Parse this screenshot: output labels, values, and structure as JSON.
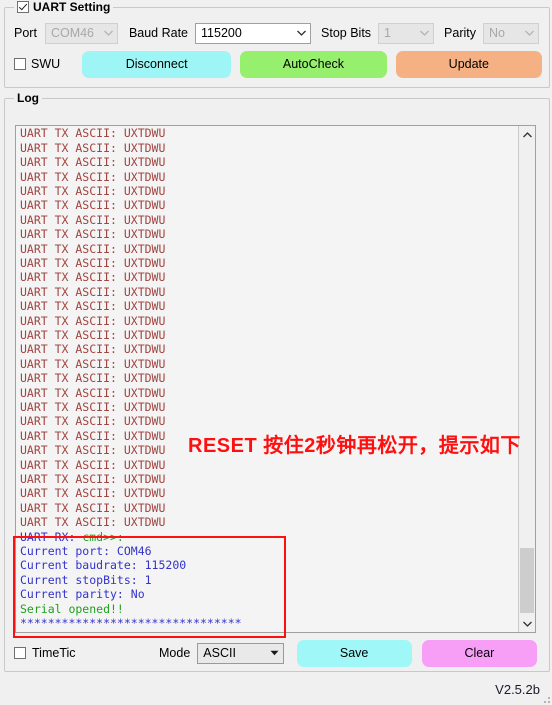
{
  "uart_group": {
    "title": "UART Setting",
    "checked": true,
    "port": {
      "label": "Port",
      "value": "COM46",
      "enabled": false
    },
    "baud_rate": {
      "label": "Baud Rate",
      "value": "115200",
      "enabled": true
    },
    "stop_bits": {
      "label": "Stop Bits",
      "value": "1",
      "enabled": false
    },
    "parity": {
      "label": "Parity",
      "value": "No",
      "enabled": false
    },
    "swu": {
      "label": "SWU",
      "checked": false
    },
    "buttons": {
      "disconnect": "Disconnect",
      "autocheck": "AutoCheck",
      "update": "Update"
    },
    "colors": {
      "disconnect": "#9df5f5",
      "autocheck": "#96f06e",
      "update": "#f5b183"
    }
  },
  "log_group": {
    "title": "Log",
    "tx_line": "UART TX ASCII: UXTDWU",
    "tx_line_count": 29,
    "rx_block": [
      {
        "parts": [
          {
            "text": "UART RX: ",
            "color": "blue"
          },
          {
            "text": "cmd>>:",
            "color": "green"
          }
        ]
      },
      {
        "parts": [
          {
            "text": "Current port: COM46",
            "color": "blue"
          }
        ]
      },
      {
        "parts": [
          {
            "text": "Current baudrate: 115200",
            "color": "blue"
          }
        ]
      },
      {
        "parts": [
          {
            "text": "Current stopBits: 1",
            "color": "blue"
          }
        ]
      },
      {
        "parts": [
          {
            "text": "Current parity: No",
            "color": "blue"
          }
        ]
      },
      {
        "parts": [
          {
            "text": "Serial opened!!",
            "color": "green"
          }
        ]
      },
      {
        "parts": [
          {
            "text": "********************************",
            "color": "blue"
          }
        ]
      }
    ],
    "colors": {
      "tx": "#a04440",
      "blue": "#3333cc",
      "green": "#20a020"
    }
  },
  "annotation": {
    "text": "RESET 按住2秒钟再松开，提示如下",
    "color": "#fd1010"
  },
  "bottom_bar": {
    "timetic": {
      "label": "TimeTic",
      "checked": false
    },
    "mode": {
      "label": "Mode",
      "value": "ASCII"
    },
    "save_label": "Save",
    "clear_label": "Clear",
    "colors": {
      "save": "#9ff7f7",
      "clear": "#f79ff7"
    }
  },
  "status": {
    "version": "V2.5.2b"
  }
}
